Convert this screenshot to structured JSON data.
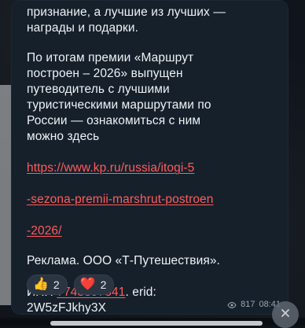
{
  "message": {
    "lines": [
      "признание, а лучшие из лучших —",
      "награды и подарки.",
      "",
      "По итогам премии «Маршрут",
      "построен – 2026» выпущен",
      "путеводитель с лучшими",
      "туристическими маршрутами по",
      "России — ознакомиться с ним",
      "можно здесь"
    ],
    "link": {
      "line1": "https://www.kp.ru/russia/itogi-5",
      "line2": "-sezona-premii-marshrut-postroen",
      "line3": "-2026/"
    },
    "ad": {
      "line1": "Реклама. ООО «Т-Путешествия».",
      "inn_label": "ИНН ",
      "inn_value": "7743397341",
      "inn_suffix": ". erid:",
      "erid": "2W5zFJkhy3X"
    }
  },
  "reactions": [
    {
      "emoji": "👍",
      "count": "2"
    },
    {
      "emoji": "❤️",
      "count": "2"
    }
  ],
  "meta": {
    "views": "817",
    "time": "08:41"
  },
  "icons": {
    "views_icon": "eye-icon",
    "close_icon": "close-icon"
  },
  "colors": {
    "bubble": "#16202b",
    "text": "#eef2f6",
    "link": "#ff5c5c",
    "reaction_bg": "#2a3442",
    "meta": "#9aa7b6"
  }
}
